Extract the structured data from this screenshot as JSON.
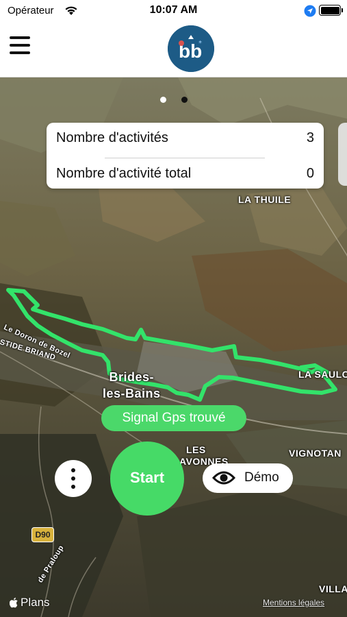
{
  "status_bar": {
    "carrier": "Opérateur",
    "time": "10:07 AM"
  },
  "header": {
    "menu_icon": "hamburger-menu-icon",
    "logo_icon": "app-logo-icon"
  },
  "pager": {
    "pages": 2,
    "current": 1
  },
  "stats": {
    "activities_label": "Nombre d'activités",
    "activities_value": "3",
    "total_label": "Nombre d'activité total",
    "total_value": "0"
  },
  "map": {
    "labels": {
      "la_thuile": "LA THUILE",
      "town_line1": "Brides-",
      "town_line2": "les-Bains",
      "la_saulce": "LA SAULCE",
      "les_avonnes_1": "LES",
      "les_avonnes_2": "AVONNES",
      "vignotan": "VIGNOTAN",
      "villa": "VILLA",
      "doron": "Le Doron de Bozel",
      "stide": "STIDE BRIAND",
      "praloup": "de Praloup"
    },
    "route_badge": "D90",
    "maps_brand": "Plans",
    "legal_link": "Mentions légales",
    "track_color": "#33e36a"
  },
  "gps_status": "Signal Gps trouvé",
  "controls": {
    "more_icon": "more-vertical-icon",
    "start_label": "Start",
    "demo_label": "Démo",
    "demo_icon": "eye-icon"
  },
  "colors": {
    "accent_green": "#46da67",
    "logo_bg": "#1d5b86"
  }
}
